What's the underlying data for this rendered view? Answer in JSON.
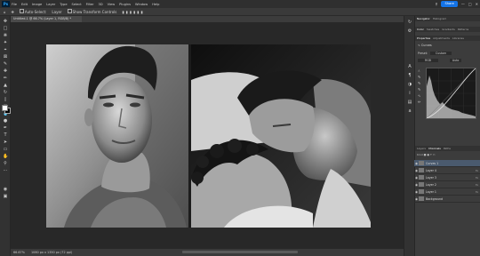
{
  "menubar": {
    "app_badge": "Ps",
    "items": [
      "File",
      "Edit",
      "Image",
      "Layer",
      "Type",
      "Select",
      "Filter",
      "3D",
      "View",
      "Plugins",
      "Window",
      "Help"
    ],
    "share_label": "Share"
  },
  "options_bar": {
    "auto_select_label": "Auto-Select:",
    "auto_select_value": "Layer",
    "show_transform_label": "Show Transform Controls"
  },
  "document": {
    "tab_title": "Untitled-1 @ 66.7% (Layer 1, RGB/8) *",
    "zoom_status": "66.67%",
    "doc_info": "1080 px x 1350 px (72 ppi)"
  },
  "panels": {
    "top_tabs": [
      "Navigator",
      "Histogram"
    ],
    "swatch_tabs": [
      "Color",
      "Swatches",
      "Gradients",
      "Patterns"
    ],
    "properties_tabs": [
      "Properties",
      "Adjustments",
      "Libraries"
    ],
    "properties_title": "Curves",
    "preset_label": "Preset:",
    "preset_value": "Custom",
    "channel_value": "RGB",
    "auto_label": "Auto",
    "layers_tabs": [
      "Layers",
      "Channels",
      "Paths"
    ],
    "kind_label": "Kind",
    "layers": [
      {
        "name": "Curves 1",
        "fx": "",
        "selected": true
      },
      {
        "name": "Layer 4",
        "fx": "fx"
      },
      {
        "name": "Layer 3",
        "fx": "fx"
      },
      {
        "name": "Layer 2",
        "fx": "fx"
      },
      {
        "name": "Layer 1",
        "fx": "fx"
      },
      {
        "name": "Background",
        "fx": ""
      }
    ]
  },
  "colors": {
    "accent": "#1473e6",
    "canvas_bg": "#282828",
    "panel_bg": "#3c3c3c"
  }
}
